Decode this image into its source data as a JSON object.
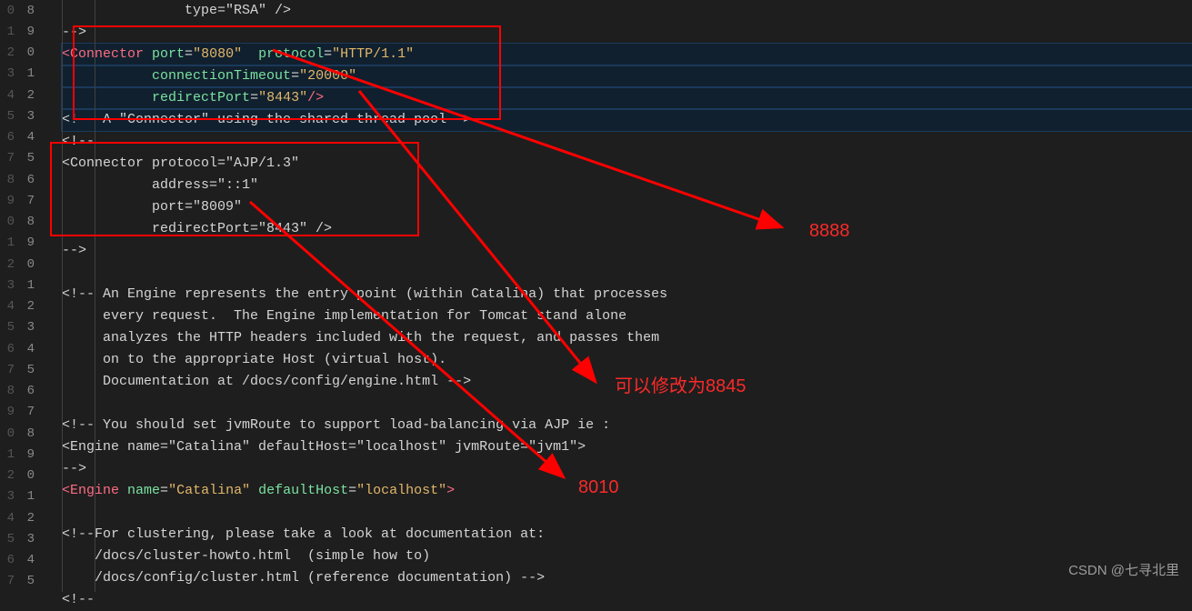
{
  "gutter": {
    "col_a": [
      "0",
      "1",
      "2",
      "3",
      "4",
      "5",
      "6",
      "7",
      "8",
      "9",
      "0",
      "1",
      "2",
      "3",
      "4",
      "5",
      "6",
      "7",
      "8",
      "9",
      "0",
      "1",
      "2",
      "3",
      "4",
      "5",
      "6",
      "7"
    ],
    "col_b": [
      "8",
      "9",
      "0",
      "1",
      "2",
      "3",
      "4",
      "5",
      "6",
      "7",
      "8",
      "9",
      "0",
      "1",
      "2",
      "3",
      "4",
      "5",
      "6",
      "7",
      "8",
      "9",
      "0",
      "1",
      "2",
      "3",
      "4",
      "5"
    ]
  },
  "code": {
    "l0": "               type=\"RSA\" />",
    "l1": "-->",
    "l2_a": "<",
    "l2_b": "Connector ",
    "l2_c": "port",
    "l2_d": "=",
    "l2_e": "\"8080\"",
    "l2_f": "  ",
    "l2_g": "protocol",
    "l2_h": "=",
    "l2_i": "\"HTTP/1.1\"",
    "l3_a": "           ",
    "l3_b": "connectionTimeout",
    "l3_c": "=",
    "l3_d": "\"20000\"",
    "l4_a": "           ",
    "l4_b": "redirectPort",
    "l4_c": "=",
    "l4_d": "\"8443\"",
    "l4_e": "/>",
    "l5": "<!-- A \"Connector\" using the shared thread pool-->",
    "l6": "<!--",
    "l7": "<Connector protocol=\"AJP/1.3\"",
    "l8": "           address=\"::1\"",
    "l9": "           port=\"8009\"",
    "l10": "           redirectPort=\"8443\" />",
    "l11": "-->",
    "l12": "",
    "l13": "<!-- An Engine represents the entry point (within Catalina) that processes",
    "l14": "     every request.  The Engine implementation for Tomcat stand alone",
    "l15": "     analyzes the HTTP headers included with the request, and passes them",
    "l16": "     on to the appropriate Host (virtual host).",
    "l17": "     Documentation at /docs/config/engine.html -->",
    "l18": "",
    "l19": "<!-- You should set jvmRoute to support load-balancing via AJP ie :",
    "l20": "<Engine name=\"Catalina\" defaultHost=\"localhost\" jvmRoute=\"jvm1\">",
    "l21": "-->",
    "l22_a": "<",
    "l22_b": "Engine ",
    "l22_c": "name",
    "l22_d": "=",
    "l22_e": "\"Catalina\"",
    "l22_f": " ",
    "l22_g": "defaultHost",
    "l22_h": "=",
    "l22_i": "\"localhost\"",
    "l22_j": ">",
    "l23": "",
    "l24": "<!--For clustering, please take a look at documentation at:",
    "l25": "    /docs/cluster-howto.html  (simple how to)",
    "l26": "    /docs/config/cluster.html (reference documentation) -->",
    "l27": "<!--"
  },
  "annotations": {
    "label1": "8888",
    "label2": "可以修改为8845",
    "label3": "8010"
  },
  "watermark": "CSDN @七寻北里"
}
